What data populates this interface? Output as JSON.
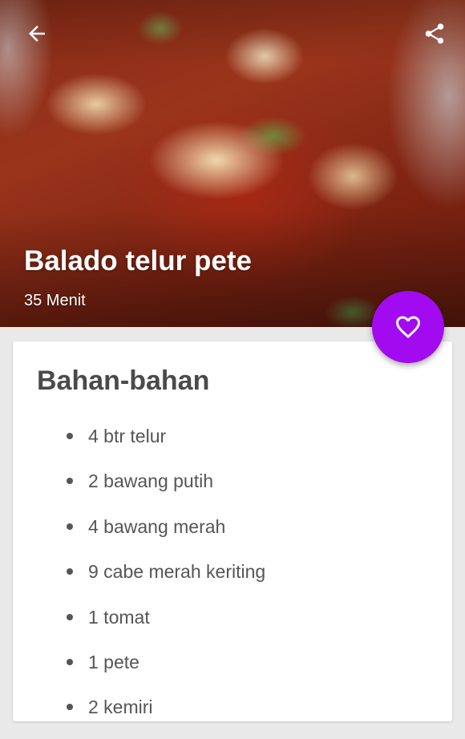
{
  "header": {
    "back_icon": "arrow-back-icon",
    "share_icon": "share-icon"
  },
  "recipe": {
    "title": "Balado telur pete",
    "duration": "35 Menit"
  },
  "favorite": {
    "icon": "heart-outline-icon",
    "color": "#a20bf0"
  },
  "ingredients_section": {
    "heading": "Bahan-bahan",
    "items": [
      "4 btr telur",
      "2 bawang putih",
      "4 bawang merah",
      "9 cabe merah keriting",
      "1 tomat",
      "1 pete",
      "2 kemiri"
    ]
  }
}
